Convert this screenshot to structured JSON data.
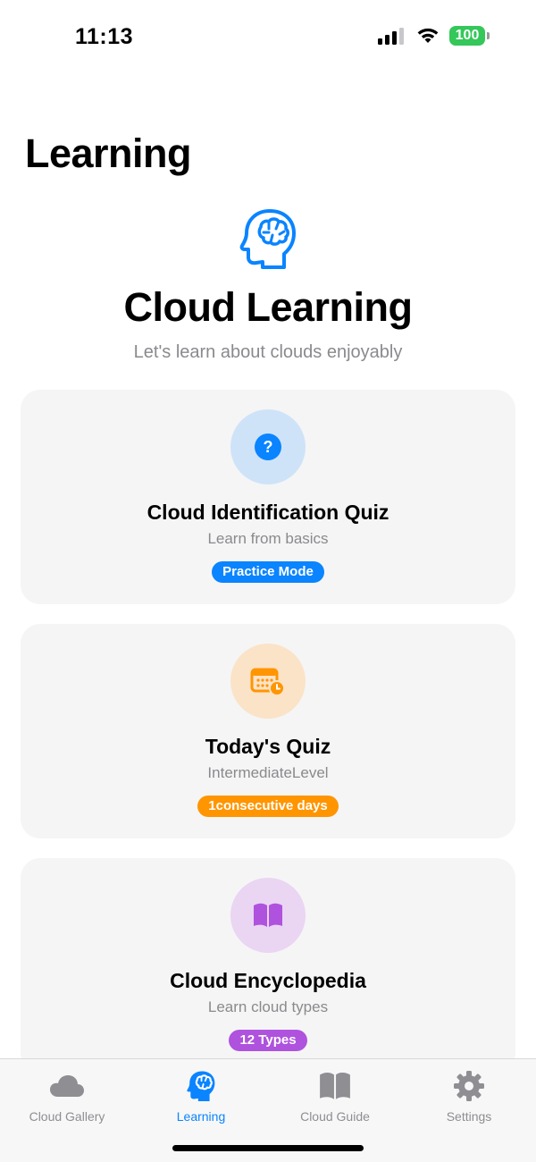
{
  "status": {
    "time": "11:13",
    "battery": "100"
  },
  "page": {
    "title": "Learning"
  },
  "hero": {
    "icon": "brain-head-icon",
    "title": "Cloud Learning",
    "subtitle": "Let's learn about clouds enjoyably"
  },
  "cards": [
    {
      "icon": "question-mark-circle-icon",
      "title": "Cloud Identification Quiz",
      "subtitle": "Learn from basics",
      "badge": "Practice Mode",
      "color": "#0a84ff",
      "tint": "#cfe3f8"
    },
    {
      "icon": "calendar-clock-icon",
      "title": "Today's Quiz",
      "subtitle": "IntermediateLevel",
      "badge": "1consecutive days",
      "color": "#ff9500",
      "tint": "#fbe3c8"
    },
    {
      "icon": "book-icon",
      "title": "Cloud Encyclopedia",
      "subtitle": "Learn cloud types",
      "badge": "12 Types",
      "color": "#af52de",
      "tint": "#ead5f3"
    }
  ],
  "tabs": [
    {
      "label": "Cloud Gallery",
      "icon": "cloud-icon",
      "active": false
    },
    {
      "label": "Learning",
      "icon": "brain-head-icon",
      "active": true
    },
    {
      "label": "Cloud Guide",
      "icon": "book-icon",
      "active": false
    },
    {
      "label": "Settings",
      "icon": "gear-icon",
      "active": false
    }
  ],
  "colors": {
    "accent": "#0a84ff",
    "inactive": "#8e8e93",
    "battery": "#34c759"
  }
}
